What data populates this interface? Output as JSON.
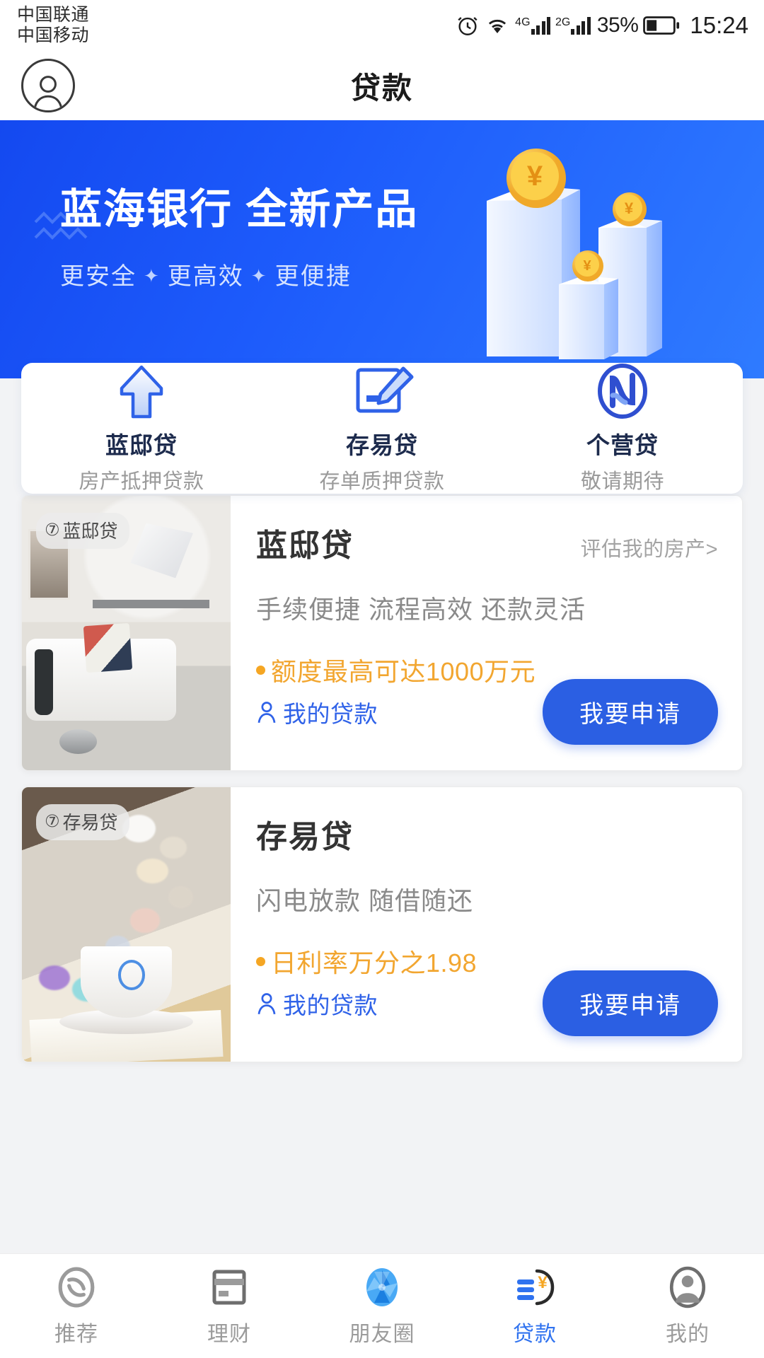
{
  "status_bar": {
    "carrier_1": "中国联通",
    "carrier_2": "中国移动",
    "net_1": "4G",
    "net_2": "2G",
    "battery": "35%",
    "time": "15:24",
    "icons": [
      "alarm-icon",
      "wifi-icon",
      "signal-icon",
      "battery-icon"
    ]
  },
  "header": {
    "title": "贷款",
    "avatar_icon": "user-avatar-icon"
  },
  "banner": {
    "headline": "蓝海银行 全新产品",
    "sub_1": "更安全",
    "sub_2": "更高效",
    "sub_3": "更便捷",
    "separator": "✦",
    "coin_symbol": "¥",
    "bg_color": "#1d5bfb"
  },
  "quick_entries": [
    {
      "title": "蓝邸贷",
      "subtitle": "房产抵押贷款",
      "icon": "house-arrow-icon"
    },
    {
      "title": "存易贷",
      "subtitle": "存单质押贷款",
      "icon": "document-pen-icon"
    },
    {
      "title": "个营贷",
      "subtitle": "敬请期待",
      "icon": "n-circle-logo-icon"
    }
  ],
  "loan_cards": [
    {
      "badge": "蓝邸贷",
      "badge_mark": "⑦",
      "title": "蓝邸贷",
      "link": "评估我的房产>",
      "desc": "手续便捷 流程高效 还款灵活",
      "highlight": "额度最高可达1000万元",
      "mine_label": "我的贷款",
      "apply_label": "我要申请",
      "thumb": "living-room-photo"
    },
    {
      "badge": "存易贷",
      "badge_mark": "⑦",
      "title": "存易贷",
      "link": "",
      "desc": "闪电放款 随借随还",
      "highlight": "日利率万分之1.98",
      "mine_label": "我的贷款",
      "apply_label": "我要申请",
      "thumb": "coffee-cup-photo"
    }
  ],
  "tabs": [
    {
      "label": "推荐",
      "icon": "brand-logo-icon",
      "active": false
    },
    {
      "label": "理财",
      "icon": "bank-card-icon",
      "active": false
    },
    {
      "label": "朋友圈",
      "icon": "aperture-icon",
      "active": false
    },
    {
      "label": "贷款",
      "icon": "loan-yen-icon",
      "active": true
    },
    {
      "label": "我的",
      "icon": "person-circle-icon",
      "active": false
    }
  ],
  "colors": {
    "accent_blue": "#2b5fe3",
    "tab_active": "#2f72ef",
    "highlight_orange": "#f2a630"
  }
}
